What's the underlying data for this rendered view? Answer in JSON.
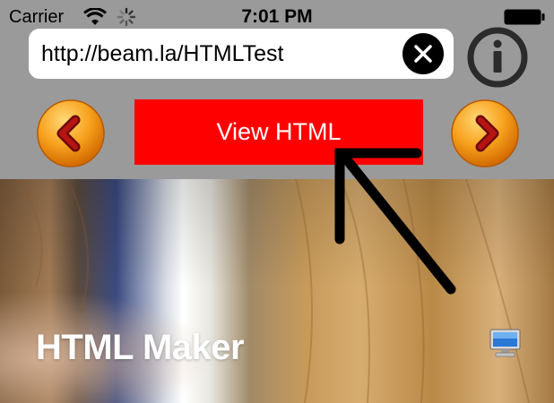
{
  "status_bar": {
    "carrier": "Carrier",
    "time": "7:01 PM",
    "icons": [
      "wifi-icon",
      "activity-spinner-icon",
      "battery-icon"
    ]
  },
  "toolbar": {
    "url": "http://beam.la/HTMLTest",
    "clear_icon": "close-icon",
    "info_icon": "info-icon",
    "prev_icon": "chevron-left-icon",
    "next_icon": "chevron-right-icon",
    "view_html_label": "View HTML"
  },
  "content": {
    "title": "HTML Maker",
    "desktop_icon": "desktop-computer-icon"
  },
  "colors": {
    "toolbar_bg": "#9a9a9a",
    "view_html_bg": "#fe0000",
    "nav_button": "#f39a1c",
    "chevron": "#a01010"
  }
}
